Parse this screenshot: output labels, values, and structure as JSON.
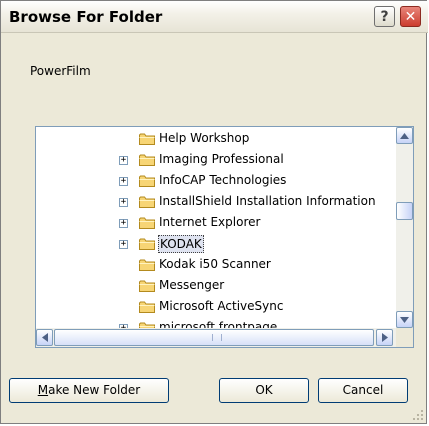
{
  "window": {
    "title": "Browse For Folder",
    "help_label": "?",
    "close_label": "✕"
  },
  "message": "PowerFilm",
  "tree": {
    "rows": [
      {
        "label": "Help Workshop",
        "expander": false,
        "selected": false
      },
      {
        "label": "Imaging Professional",
        "expander": true,
        "selected": false
      },
      {
        "label": "InfoCAP Technologies",
        "expander": true,
        "selected": false
      },
      {
        "label": "InstallShield Installation Information",
        "expander": true,
        "selected": false
      },
      {
        "label": "Internet Explorer",
        "expander": true,
        "selected": false
      },
      {
        "label": "KODAK",
        "expander": true,
        "selected": true
      },
      {
        "label": "Kodak i50 Scanner",
        "expander": false,
        "selected": false
      },
      {
        "label": "Messenger",
        "expander": false,
        "selected": false
      },
      {
        "label": "Microsoft ActiveSync",
        "expander": false,
        "selected": false
      },
      {
        "label": "microsoft frontpage",
        "expander": true,
        "selected": false
      }
    ],
    "expander_glyph": "+"
  },
  "buttons": {
    "make_new_folder_mnemonic": "M",
    "make_new_folder_rest": "ake New Folder",
    "ok": "OK",
    "cancel": "Cancel"
  },
  "icons": {
    "folder": "folder-icon",
    "scroll_up": "scroll-up-arrow-icon",
    "scroll_down": "scroll-down-arrow-icon",
    "scroll_left": "scroll-left-arrow-icon",
    "scroll_right": "scroll-right-arrow-icon"
  }
}
